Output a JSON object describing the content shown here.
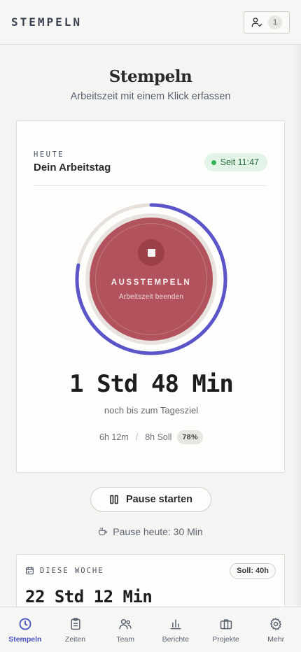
{
  "header": {
    "brand": "STEMPELN",
    "team_count": "1"
  },
  "page": {
    "title": "Stempeln",
    "subtitle": "Arbeitszeit mit einem Klick erfassen"
  },
  "today_card": {
    "label": "HEUTE",
    "title": "Dein Arbeitstag",
    "since": "Seit 11:47",
    "progress_fraction": 0.78,
    "stop_label": "AUSSTEMPELN",
    "stop_sub": "Arbeitszeit beenden",
    "remaining": "1 Std 48 Min",
    "remaining_sub": "noch bis zum Tagesziel",
    "worked": "6h 12m",
    "separator": "/",
    "target": "8h Soll",
    "percent": "78%"
  },
  "pause": {
    "button_label": "Pause starten",
    "info": "Pause heute: 30 Min"
  },
  "week_card": {
    "label": "DIESE WOCHE",
    "soll": "Soll: 40h",
    "total": "22 Std 12 Min"
  },
  "nav": [
    {
      "label": "Stempeln",
      "icon": "clock-icon",
      "active": true
    },
    {
      "label": "Zeiten",
      "icon": "clipboard-icon",
      "active": false
    },
    {
      "label": "Team",
      "icon": "users-icon",
      "active": false
    },
    {
      "label": "Berichte",
      "icon": "bar-chart-icon",
      "active": false
    },
    {
      "label": "Projekte",
      "icon": "briefcase-icon",
      "active": false
    },
    {
      "label": "Mehr",
      "icon": "gear-icon",
      "active": false
    }
  ],
  "colors": {
    "accent": "#5b55c9",
    "stop": "#b1525c",
    "active_nav": "#4a52c0",
    "status_green": "#2fb65a"
  }
}
